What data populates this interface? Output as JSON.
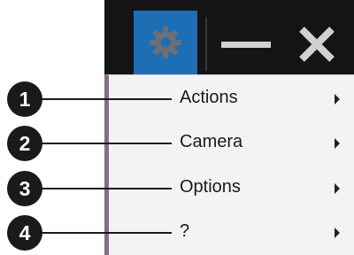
{
  "titlebar": {
    "icons": [
      "gear-icon",
      "minimize-icon",
      "close-icon"
    ],
    "accent_color": "#1c6fb4",
    "background_color": "#141414"
  },
  "menu": {
    "items": [
      {
        "label": "Actions",
        "has_submenu": true
      },
      {
        "label": "Camera",
        "has_submenu": true
      },
      {
        "label": "Options",
        "has_submenu": true
      },
      {
        "label": "?",
        "has_submenu": true
      }
    ]
  },
  "callouts": [
    "1",
    "2",
    "3",
    "4"
  ]
}
